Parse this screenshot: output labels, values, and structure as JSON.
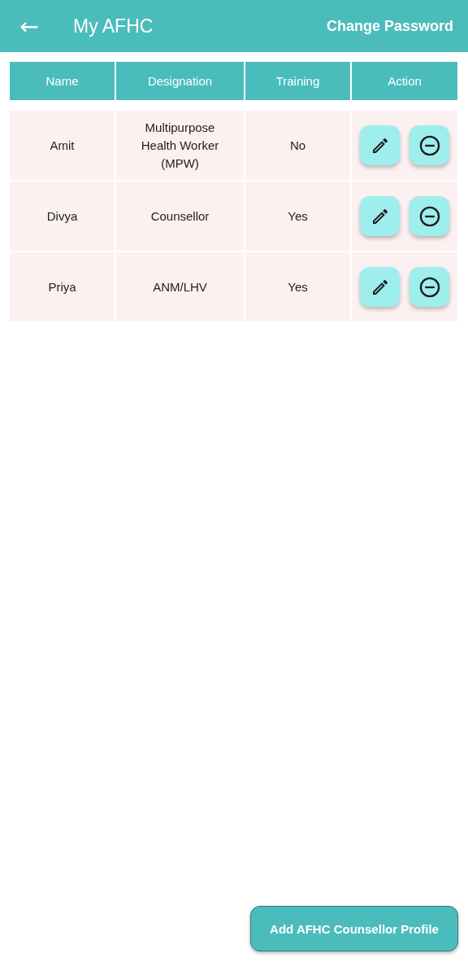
{
  "app_bar": {
    "back_icon": "←",
    "title": "My AFHC",
    "action": "Change Password"
  },
  "table": {
    "columns": [
      "Name",
      "Designation",
      "Training",
      "Action"
    ],
    "rows": [
      {
        "name": "Amit",
        "designation": "Multipurpose Health Worker (MPW)",
        "training": "No"
      },
      {
        "name": "Divya",
        "designation": "Counsellor",
        "training": "Yes"
      },
      {
        "name": "Priya",
        "designation": "ANM/LHV",
        "training": "Yes"
      }
    ]
  },
  "add_button": "Add AFHC Counsellor Profile"
}
